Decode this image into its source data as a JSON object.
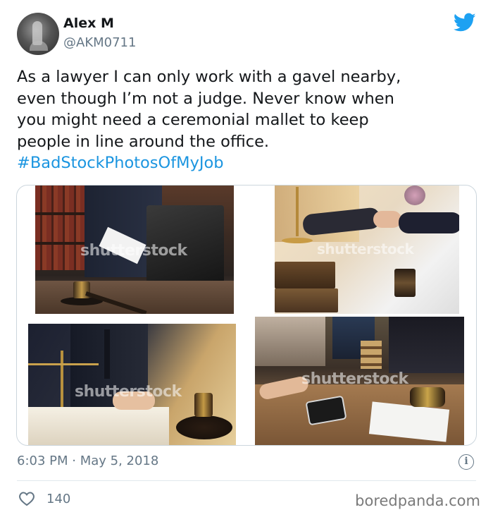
{
  "tweet": {
    "author": {
      "display_name": "Alex M",
      "handle": "@AKM0711",
      "avatar_icon": "profile-photo"
    },
    "text_lines": [
      "As a lawyer I can only work with a gavel nearby,",
      "even though I’m not a judge. Never know when",
      "you might need a ceremonial mallet to keep",
      "people in line around the office."
    ],
    "hashtag": "#BadStockPhotosOfMyJob",
    "media": [
      {
        "alt": "bookshelf-briefcase-gavel-photo",
        "watermark": "shutterstock"
      },
      {
        "alt": "handshake-scales-gavel-photo",
        "watermark": "shutterstock"
      },
      {
        "alt": "signing-document-scales-gavel-photo",
        "watermark": "shutterstock"
      },
      {
        "alt": "meeting-table-gavel-photo",
        "watermark": "shutterstock"
      }
    ],
    "timestamp": "6:03 PM · May 5, 2018",
    "like_count": "140"
  },
  "branding": {
    "platform_icon": "twitter-bird-icon",
    "accent_color": "#1da1f2",
    "credit": "boredpanda.com"
  }
}
